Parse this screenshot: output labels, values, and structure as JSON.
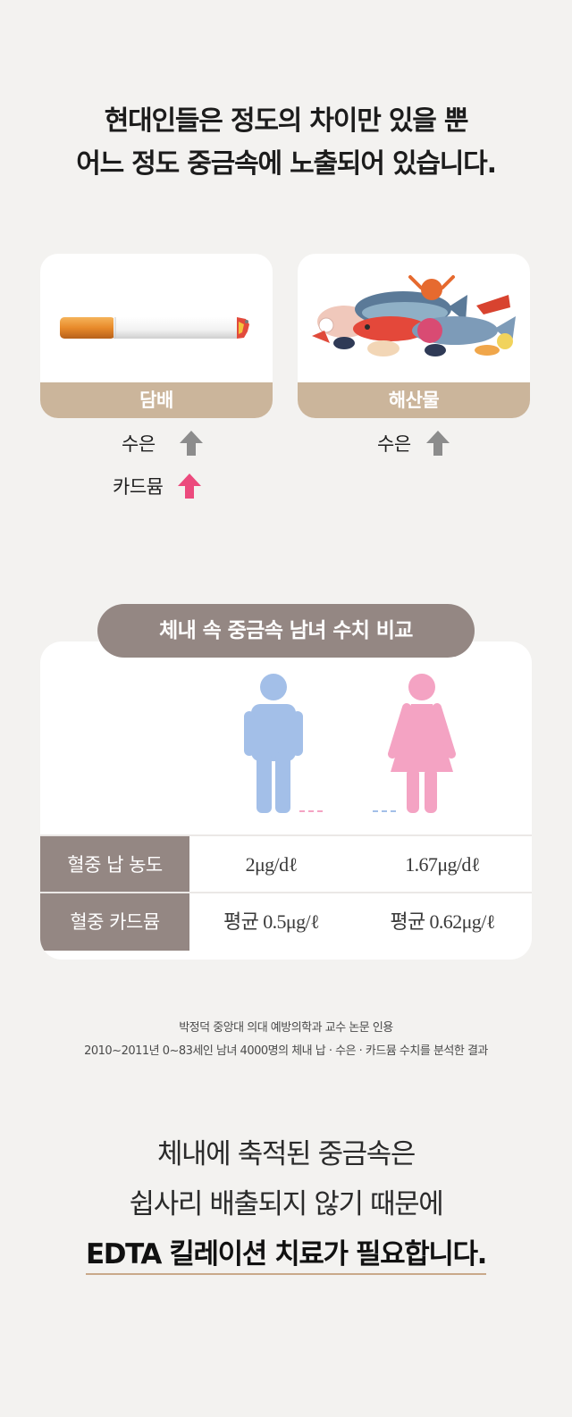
{
  "headline": {
    "line1": "현대인들은 정도의 차이만 있을 뿐",
    "line2": "어느 정도 중금속에 노출되어 있습니다."
  },
  "sources": [
    {
      "label": "담배",
      "image": "cigarette-illustration",
      "metals": [
        {
          "name": "수은",
          "trend": "up",
          "arrow_color": "#8c8c8c"
        },
        {
          "name": "카드뮴",
          "trend": "up",
          "arrow_color": "#ec4a7d"
        }
      ]
    },
    {
      "label": "해산물",
      "image": "seafood-illustration",
      "metals": [
        {
          "name": "수은",
          "trend": "up",
          "arrow_color": "#8c8c8c"
        }
      ]
    }
  ],
  "comparison": {
    "title": "체내 속 중금속 남녀 수치 비교",
    "male_icon": "male-person-icon",
    "female_icon": "female-person-icon",
    "male_color": "#a3bfe8",
    "female_color": "#f4a3c3",
    "rows": [
      {
        "label": "혈중 납 농도",
        "male": "2μg/dℓ",
        "female": "1.67μg/dℓ"
      },
      {
        "label": "혈중 카드뮴",
        "male": "평균 0.5μg/ℓ",
        "female": "평균 0.62μg/ℓ"
      }
    ]
  },
  "citation": {
    "line1": "박정덕 중앙대 의대 예방의학과 교수 논문 인용",
    "line2": "2010~2011년 0~83세인 남녀 4000명의 체내 납 · 수은 · 카드뮴 수치를 분석한 결과"
  },
  "conclusion": {
    "line1": "체내에 축적된 중금속은",
    "line2": "쉽사리 배출되지 않기 때문에",
    "line3": "EDTA 킬레이션 치료가 필요합니다."
  },
  "colors": {
    "background": "#f3f2f0",
    "card_label": "#cbb59b",
    "pill": "#948783",
    "underline": "#c9a98a"
  }
}
